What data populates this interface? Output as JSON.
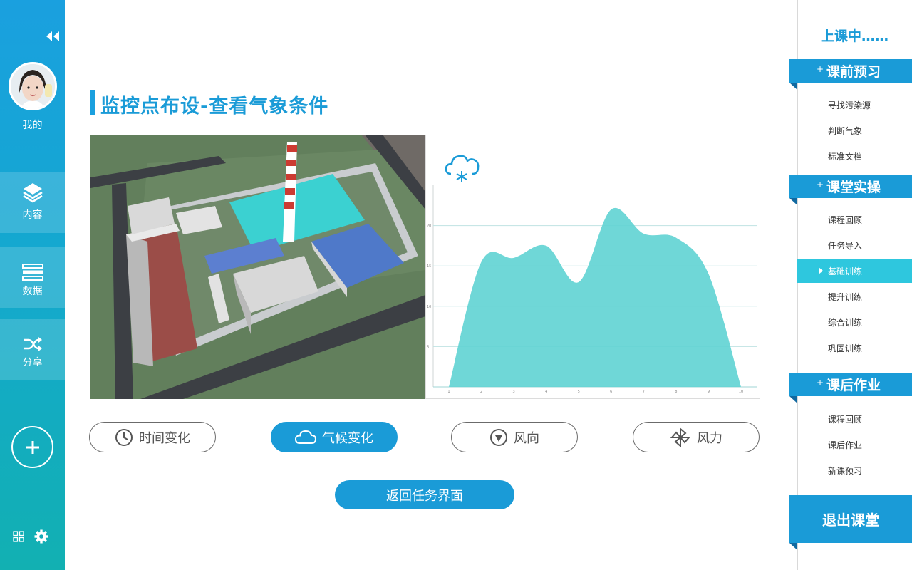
{
  "sidebar": {
    "profile_label": "我的",
    "nav": [
      {
        "label": "内容",
        "icon": "layers-icon"
      },
      {
        "label": "数据",
        "icon": "data-list-icon"
      },
      {
        "label": "分享",
        "icon": "shuffle-icon"
      }
    ],
    "icons": {
      "collapse": "double-chevron-left-icon",
      "add": "plus-circle-icon",
      "grid": "grid-icon",
      "settings": "gear-icon"
    }
  },
  "main": {
    "title": "监控点布设-查看气象条件",
    "weather_icon": "cloud-snow-icon",
    "tabs": [
      {
        "label": "时间变化",
        "icon": "clock-icon",
        "active": false
      },
      {
        "label": "气候变化",
        "icon": "cloud-icon",
        "active": true
      },
      {
        "label": "风向",
        "icon": "wind-direction-icon",
        "active": false
      },
      {
        "label": "风力",
        "icon": "pinwheel-icon",
        "active": false
      }
    ],
    "return_button": "返回任务界面"
  },
  "right_panel": {
    "status": "上课中……",
    "sections": [
      {
        "label": "课前预习",
        "items": [
          "寻找污染源",
          "判断气象",
          "标准文档"
        ]
      },
      {
        "label": "课堂实操",
        "items": [
          "课程回顾",
          "任务导入",
          "基础训练",
          "提升训练",
          "综合训练",
          "巩固训练"
        ]
      },
      {
        "label": "课后作业",
        "items": [
          "课程回顾",
          "课后作业",
          "新课预习"
        ]
      }
    ],
    "active_item": "基础训练",
    "exit_button": "退出课堂"
  },
  "colors": {
    "primary": "#1a9bd7",
    "accent": "#2ec7de",
    "area_fill": "#5fd3d3"
  },
  "chart_data": {
    "type": "area",
    "x": [
      1,
      2,
      3,
      4,
      5,
      6,
      7,
      8,
      9,
      10
    ],
    "values": [
      0,
      15.5,
      16,
      17.5,
      13,
      22,
      19,
      18.5,
      14,
      0
    ],
    "xticks": [
      "1",
      "2",
      "3",
      "4",
      "5",
      "6",
      "7",
      "8",
      "9",
      "10"
    ],
    "yticks": [
      "5",
      "10",
      "15",
      "20"
    ],
    "ylim": [
      0,
      25
    ],
    "grid": true
  }
}
